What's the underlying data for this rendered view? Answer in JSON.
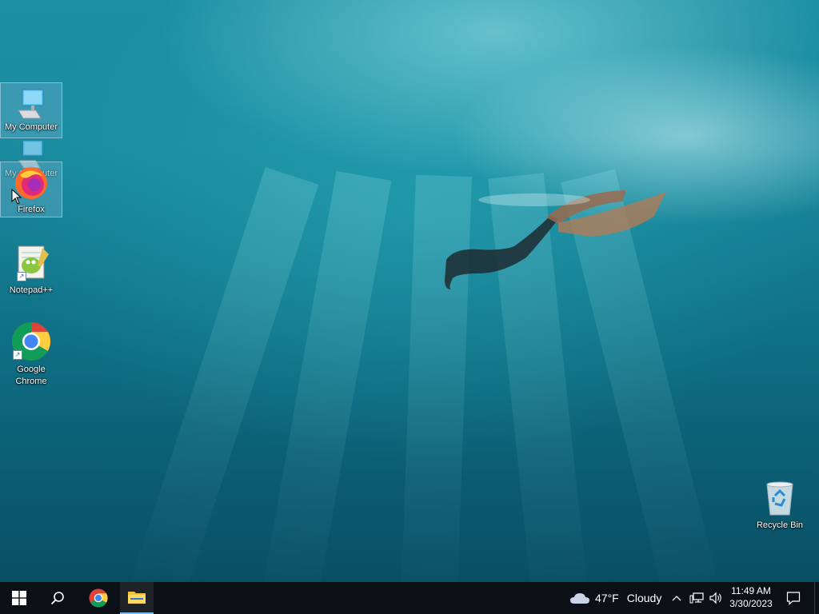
{
  "desktop": {
    "icons": [
      {
        "label": "My Computer"
      },
      {
        "label": "My Computer"
      },
      {
        "label": "Firefox"
      },
      {
        "label": "Notepad++"
      },
      {
        "label": "Google Chrome"
      },
      {
        "label": "Recycle Bin"
      }
    ]
  },
  "taskbar": {
    "weather": {
      "temp": "47°F",
      "condition": "Cloudy"
    },
    "clock": {
      "time": "11:49 AM",
      "date": "3/30/2023"
    }
  },
  "colors": {
    "taskbar_bg": "#0b1016",
    "active_indicator": "#76b9ed",
    "windows_logo": "#ffffff"
  },
  "icons": [
    "windows-start-icon",
    "search-icon",
    "chrome-icon",
    "file-explorer-icon",
    "cloud-icon",
    "chevron-up-icon",
    "network-icon",
    "speaker-icon",
    "notification-icon",
    "computer-icon",
    "firefox-icon",
    "notepadpp-icon",
    "recycle-bin-icon"
  ]
}
